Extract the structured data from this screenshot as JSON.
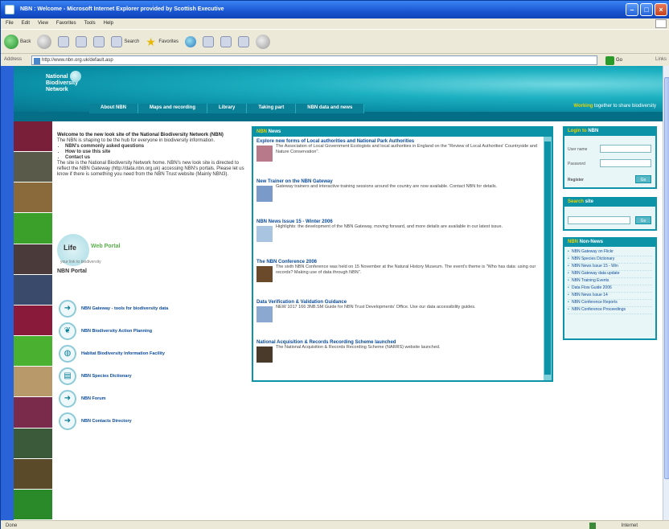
{
  "window": {
    "title": "NBN : Welcome - Microsoft Internet Explorer provided by Scottish Executive",
    "menu": [
      "File",
      "Edit",
      "View",
      "Favorites",
      "Tools",
      "Help"
    ],
    "toolbar": {
      "back": "Back",
      "search": "Search",
      "favorites": "Favorites"
    },
    "address_label": "Address",
    "address_value": "http://www.nbn.org.uk/default.asp",
    "go_label": "Go",
    "links_label": "Links"
  },
  "site": {
    "logo_line1": "National",
    "logo_line2": "Biodiversity",
    "logo_line3": "Network",
    "logo_sub": "",
    "tagline_highlight": "Working",
    "tagline_rest": " together to share biodiversity",
    "nav": [
      "About NBN",
      "Maps and recording",
      "Library",
      "Taking part",
      "NBN data and news"
    ]
  },
  "intro": {
    "heading": "Welcome to the new look site of the National Biodiversity Network (NBN)",
    "para1": "The NBN is shaping to be the hub for everyone in biodiversity information.",
    "bullets": [
      "NBN's commonly asked questions",
      "How to use this site",
      "Contact us"
    ],
    "para2": "The site is the National Biodiversity Network home. NBN's new look site is directed to reflect the NBN Gateway (http://data.nbn.org.uk) accessing NBN's portals. Please let us know if there is something you need from the NBN Trust website (Mainly NBN3)."
  },
  "lwp": {
    "word1": "Life",
    "word2": "Web",
    "word3": "Portal",
    "sub": "your link to biodiversity"
  },
  "portal": {
    "title": "NBN Portal",
    "items": [
      "NBN Gateway - tools for biodiversity data",
      "NBN Biodiversity Action Planning",
      "Habitat Biodiversity Information Facility",
      "NBN Species Dictionary",
      "NBN Forum",
      "NBN Contacts Directory"
    ]
  },
  "news": {
    "title_hl": "NBN",
    "title": " News",
    "items": [
      {
        "title": "Explore new forms of Local authorities and National Park Authorities",
        "desc": "The Association of Local Government Ecologists and local authorities in England on the \"Review of Local Authorities' Countryside and Nature Conservation\"."
      },
      {
        "title": "New Trainer on the NBN Gateway",
        "desc": "Gateway trainers and interactive training sessions around the country are now available. Contact NBN for details."
      },
      {
        "title": "NBN News Issue 15 - Winter 2006",
        "desc": "Highlights: the development of the NBN Gateway, moving forward, and more details are available in our latest issue."
      },
      {
        "title": "The NBN Conference 2006",
        "desc": "The sixth NBN Conference was held on 15 November at the Natural History Museum. The event's theme is \"Who has data: using our records? Making use of data through NBN\"."
      },
      {
        "title": "Data Verification & Validation Guidance",
        "desc": "NEW 1017 166 3NB.SM Guide for NBN Trust Developments' Office. Use our data accessibility guides."
      },
      {
        "title": "National Acquisition & Records Recording Scheme launched",
        "desc": "The National Acquisition & Records Recording Scheme (NARRS) website launched."
      }
    ]
  },
  "login": {
    "title_hl": "Login to",
    "title": " NBN",
    "user_label": "User name",
    "pass_label": "Password",
    "register": "Register",
    "go": "Go"
  },
  "search_box": {
    "title_hl": "Search",
    "title": " site",
    "go": "Go"
  },
  "nonews": {
    "title_hl": "NBN",
    "title": " Non-News",
    "items": [
      "NBN Gateway on Flickr",
      "NBN Species Dictionary",
      "NBN News Issue 15 - Win",
      "NBN Gateway data update",
      "NBN Training Events",
      "Data Flow Guide 2006",
      "NBN News Issue 14",
      "NBN Conference Reports",
      "NBN Conference Proceedings"
    ]
  },
  "status": {
    "left": "Done",
    "right": "Internet"
  },
  "colors": {
    "brand_teal": "#0d93a8",
    "accent_yellow": "#e8d200"
  }
}
